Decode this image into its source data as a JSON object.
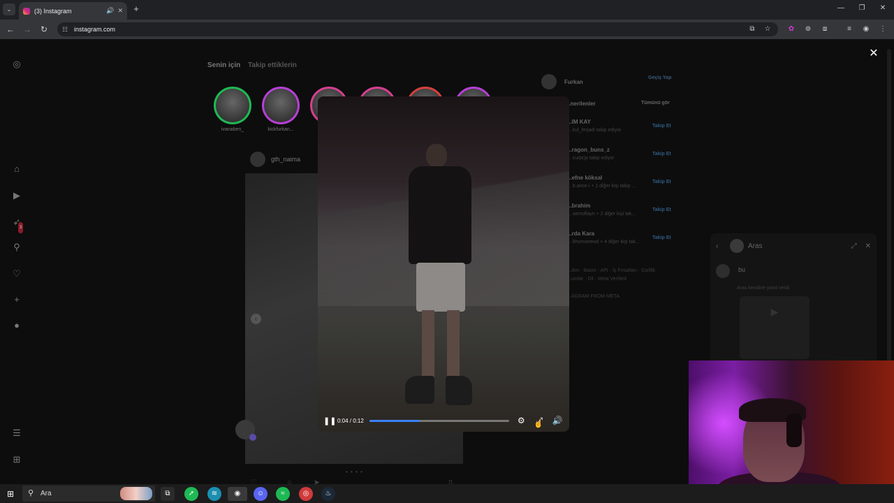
{
  "browser": {
    "tab_title": "(3) Instagram",
    "new_tab_icon": "+",
    "url": "instagram.com",
    "window_controls": [
      "minimize",
      "maximize",
      "close"
    ]
  },
  "feed": {
    "tabs": [
      "Senin için",
      "Takip ettiklerin"
    ],
    "stories": [
      {
        "name": "ivanaben_",
        "ring": "#1fb954"
      },
      {
        "name": "kickfurkan...",
        "ring": "#b73fd6"
      },
      {
        "name": "",
        "ring": "#d63f8f"
      },
      {
        "name": "",
        "ring": "#d63f8f"
      },
      {
        "name": "",
        "ring": "#d63f3f"
      },
      {
        "name": "",
        "ring": "#b73fd6"
      }
    ],
    "post_author": "gth_naima"
  },
  "sidebar": {
    "icons": [
      "instagram-icon",
      "home-icon",
      "reels-icon",
      "messages-icon",
      "search-icon",
      "heart-icon",
      "create-icon",
      "profile-icon",
      "menu-icon",
      "apps-icon"
    ],
    "messages_badge": "3"
  },
  "right": {
    "username": "Furkan",
    "switch": "Geçiş Yap",
    "suggestions_title": "...nerilenler",
    "see_all": "Tümünü gör",
    "suggestions": [
      {
        "name": "...IM KAY",
        "sub": "... kul_ferjadi takip ediyor",
        "action": "Takip Et"
      },
      {
        "name": "...ragon_buns_z",
        "sub": "... cuda'ja takip ediyor",
        "action": "Takip Et"
      },
      {
        "name": "...efne köksal",
        "sub": "... b.ance.i + 1 diğer kişi takip ...",
        "action": "Takip Et"
      },
      {
        "name": "...brahim",
        "sub": "... xemoflayn + 2 diğer kişi tak...",
        "action": "Takip Et"
      },
      {
        "name": "...rda Kara",
        "sub": "... khvmoeewd + 4 diğer kişi tak...",
        "action": "Takip Et"
      }
    ],
    "footer1": "...dım · Basın · API · İş Fırsatları · Gizlilik ·",
    "footer2": "...umlar · Dil · Meta Verified",
    "footer3": "...AGRAM FROM META"
  },
  "chat": {
    "name": "Aras",
    "message": "bu",
    "note": "Aras kendine yanıt verdi"
  },
  "player": {
    "time": "0:04 / 0:12",
    "progress": 0.36,
    "buttons": [
      "pause-icon",
      "settings-icon",
      "fullscreen-icon",
      "volume-icon"
    ]
  },
  "taskbar": {
    "search_placeholder": "Ara",
    "apps": [
      {
        "name": "task-view-icon",
        "color": "#2b2b2b"
      },
      {
        "name": "app-green-icon",
        "color": "#1fb954"
      },
      {
        "name": "app-cyan-icon",
        "color": "#1c8fb0"
      },
      {
        "name": "chrome-icon",
        "color": "#3a7bd5"
      },
      {
        "name": "discord-icon",
        "color": "#5865f2"
      },
      {
        "name": "spotify-icon",
        "color": "#1db954"
      },
      {
        "name": "obs-icon",
        "color": "#d03a3a"
      },
      {
        "name": "steam-icon",
        "color": "#1b2838"
      }
    ]
  }
}
